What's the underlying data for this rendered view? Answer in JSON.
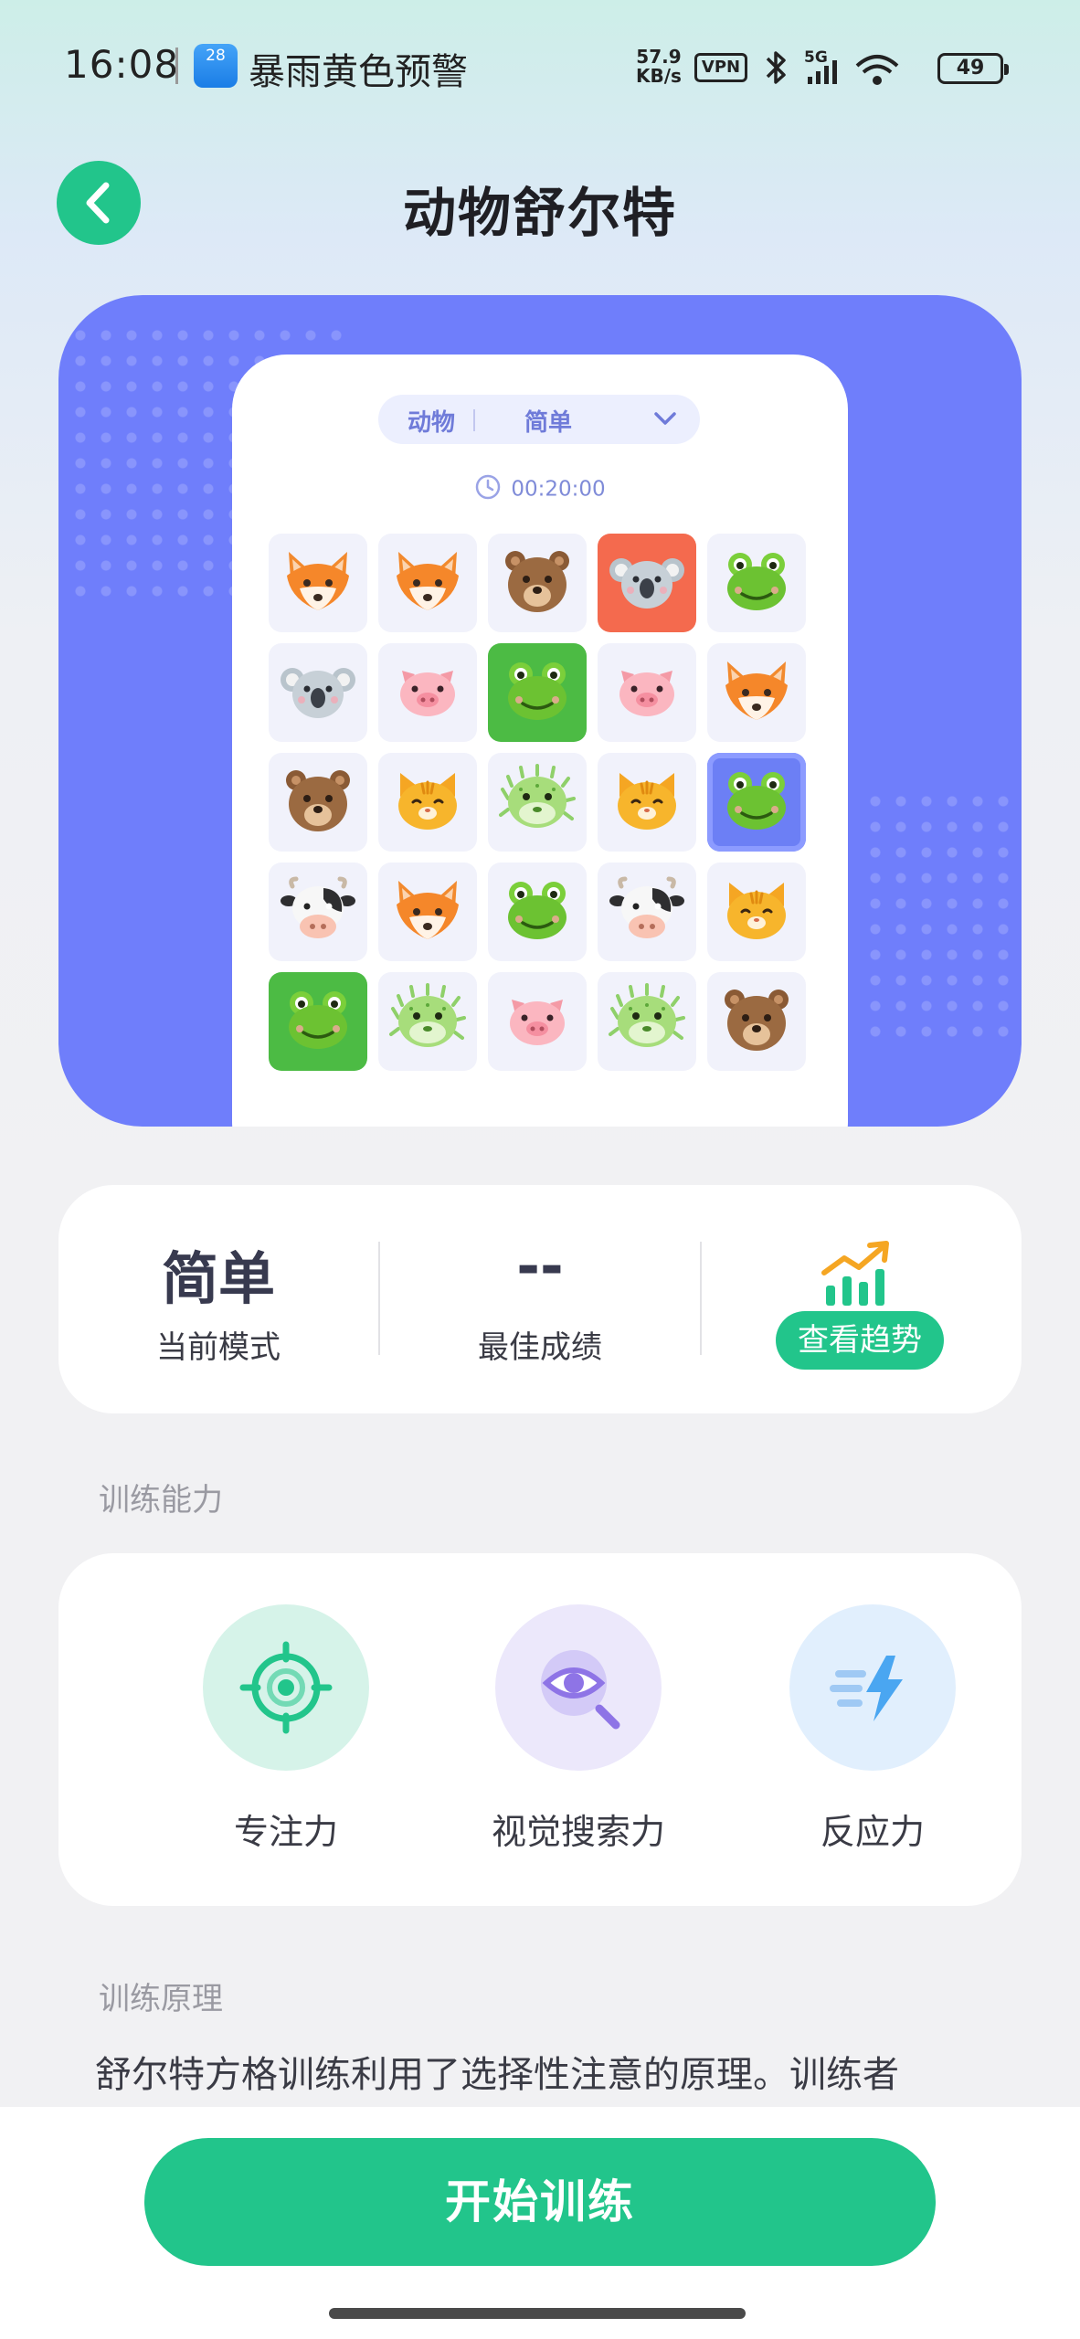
{
  "status_bar": {
    "time": "16:08",
    "weather_badge": "28",
    "weather_alert": "暴雨黄色预警",
    "net_speed_value": "57.9",
    "net_speed_unit": "KB/s",
    "vpn": "VPN",
    "network": "5G",
    "battery": "49"
  },
  "header": {
    "title": "动物舒尔特"
  },
  "preview": {
    "category": "动物",
    "difficulty": "简单",
    "timer": "00:20:00",
    "hint": "",
    "grid": [
      [
        "fox",
        "fox",
        "bear",
        "koala",
        "frog"
      ],
      [
        "koala",
        "pig",
        "frog",
        "pig",
        "fox"
      ],
      [
        "bear",
        "cat",
        "pufferfish",
        "cat",
        "frog"
      ],
      [
        "cow",
        "fox",
        "frog",
        "cow",
        "cat"
      ],
      [
        "frog",
        "pufferfish",
        "pig",
        "pufferfish",
        "bear"
      ]
    ],
    "highlights": {
      "0-3": "red",
      "1-2": "green",
      "2-4": "blue",
      "4-0": "green"
    }
  },
  "stats": {
    "mode_value": "简单",
    "mode_label": "当前模式",
    "best_value": "--",
    "best_label": "最佳成绩",
    "trend_button": "查看趋势"
  },
  "abilities_section": {
    "label": "训练能力",
    "items": [
      {
        "label": "专注力",
        "icon": "target-icon"
      },
      {
        "label": "视觉搜索力",
        "icon": "eye-search-icon"
      },
      {
        "label": "反应力",
        "icon": "lightning-icon"
      }
    ]
  },
  "principle_section": {
    "label": "训练原理",
    "text": "舒尔特方格训练利用了选择性注意的原理。训练者"
  },
  "actions": {
    "start": "开始训练"
  },
  "colors": {
    "accent": "#22c58b",
    "preview_bg": "#6f7efb"
  }
}
